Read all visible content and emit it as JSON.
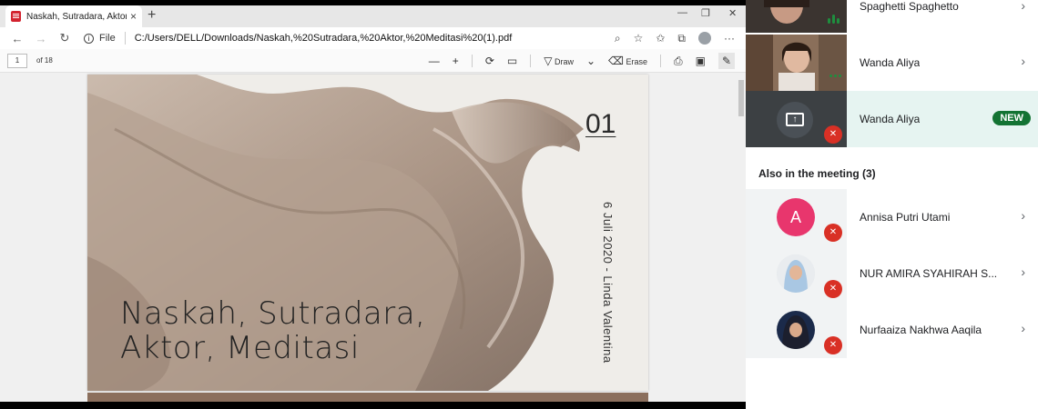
{
  "browser": {
    "tab": {
      "title": "Naskah, Sutradara, Aktor, Meditasi",
      "close": "×"
    },
    "new_tab": "+",
    "window_controls": {
      "minimize": "—",
      "maximize": "❐",
      "close": "✕"
    },
    "address": {
      "back": "←",
      "forward": "→",
      "reload": "↻",
      "scheme_label": "File",
      "url": "C:/Users/DELL/Downloads/Naskah,%20Sutradara,%20Aktor,%20Meditasi%20(1).pdf",
      "more": "···"
    },
    "pdf_toolbar": {
      "page_current": "1",
      "page_total_label": "of 18",
      "zoom_out": "—",
      "zoom_in": "+",
      "draw_label": "Draw",
      "erase_label": "Erase"
    }
  },
  "document": {
    "page_number": "01",
    "date_author": "6 Juli 2020 - Linda Valentina",
    "title_line1": "Naskah, Sutradara,",
    "title_line2": "Aktor, Meditasi"
  },
  "meet": {
    "participants_top": [
      {
        "name": "Spaghetti Spaghetto"
      },
      {
        "name": "Wanda Aliya"
      },
      {
        "name": "Wanda Aliya",
        "badge": "NEW"
      }
    ],
    "also_title": "Also in the meeting (3)",
    "also_in_meeting": [
      {
        "name": "Annisa Putri Utami",
        "initial": "A"
      },
      {
        "name": "NUR AMIRA SYAHIRAH S..."
      },
      {
        "name": "Nurfaaiza Nakhwa Aaqila"
      }
    ],
    "colors": {
      "accent_green": "#137333",
      "mic_red": "#d93025",
      "avatar_pink": "#e8366d"
    }
  }
}
